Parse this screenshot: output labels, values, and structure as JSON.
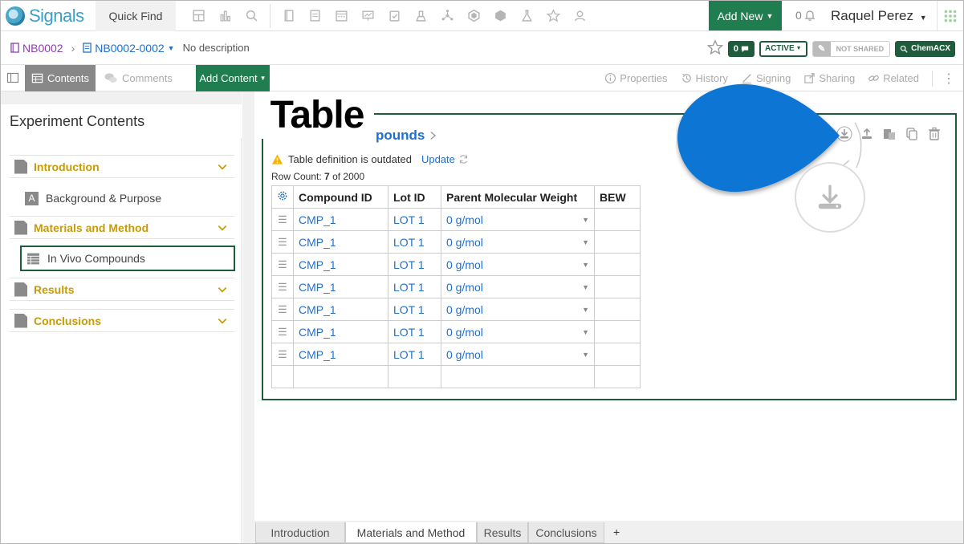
{
  "app": {
    "logo_text": "Signals",
    "quick_find": "Quick Find",
    "add_new": "Add New",
    "notif_count": "0",
    "user_name": "Raquel Perez"
  },
  "breadcrumb": {
    "notebook": "NB0002",
    "experiment": "NB0002-0002",
    "description": "No description",
    "comment_count": "0",
    "status": "ACTIVE",
    "shared": "NOT SHARED",
    "chem": "ChemACX"
  },
  "toolbar": {
    "contents": "Contents",
    "comments": "Comments",
    "add_content": "Add Content",
    "properties": "Properties",
    "history": "History",
    "signing": "Signing",
    "sharing": "Sharing",
    "related": "Related"
  },
  "sidebar": {
    "title": "Experiment Contents",
    "sections": [
      {
        "label": "Introduction"
      },
      {
        "label": "Materials and Method"
      },
      {
        "label": "Results"
      },
      {
        "label": "Conclusions"
      }
    ],
    "sub_items": [
      {
        "letter": "A",
        "label": "Background & Purpose"
      },
      {
        "label": "In Vivo Compounds"
      }
    ]
  },
  "table": {
    "title_fragment": "pounds",
    "warning": "Table definition is outdated",
    "update": "Update",
    "row_count_label": "Row Count:",
    "row_count": "7",
    "row_count_of": "of 2000",
    "columns": [
      "Compound ID",
      "Lot ID",
      "Parent Molecular Weight",
      "BEW"
    ],
    "rows": [
      {
        "compound": "CMP_1",
        "lot": "LOT 1",
        "mw": "0 g/mol"
      },
      {
        "compound": "CMP_1",
        "lot": "LOT 1",
        "mw": "0 g/mol"
      },
      {
        "compound": "CMP_1",
        "lot": "LOT 1",
        "mw": "0 g/mol"
      },
      {
        "compound": "CMP_1",
        "lot": "LOT 1",
        "mw": "0 g/mol"
      },
      {
        "compound": "CMP_1",
        "lot": "LOT 1",
        "mw": "0 g/mol"
      },
      {
        "compound": "CMP_1",
        "lot": "LOT 1",
        "mw": "0 g/mol"
      },
      {
        "compound": "CMP_1",
        "lot": "LOT 1",
        "mw": "0 g/mol"
      }
    ]
  },
  "tabs": [
    "Introduction",
    "Materials and Method",
    "Results",
    "Conclusions"
  ],
  "tab_add": "+",
  "callout": {
    "label": "Table"
  },
  "colors": {
    "brand_green": "#1f7d4f",
    "dark_green": "#1f5c3d",
    "link_blue": "#1f6fce",
    "section_gold": "#c79b06",
    "callout_blue": "#0c74d4"
  }
}
